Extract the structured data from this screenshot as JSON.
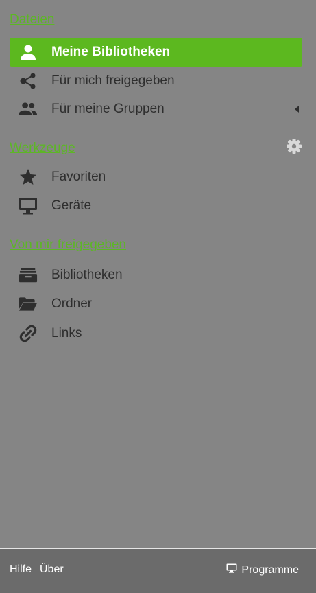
{
  "sections": {
    "files": {
      "heading": "Dateien"
    },
    "tools": {
      "heading": "Werkzeuge"
    },
    "shared_by_me": {
      "heading": "Von mir freigegeben"
    }
  },
  "nav": {
    "my_libraries": "Meine Bibliotheken",
    "shared_with_me": "Für mich freigegeben",
    "my_groups": "Für meine Gruppen",
    "favorites": "Favoriten",
    "devices": "Geräte",
    "libraries": "Bibliotheken",
    "folders": "Ordner",
    "links": "Links"
  },
  "footer": {
    "help": "Hilfe",
    "about": "Über",
    "apps": "Programme"
  },
  "colors": {
    "accent": "#5cb81f",
    "panel_bg": "#858585",
    "footer_bg": "#6b6b6b"
  }
}
